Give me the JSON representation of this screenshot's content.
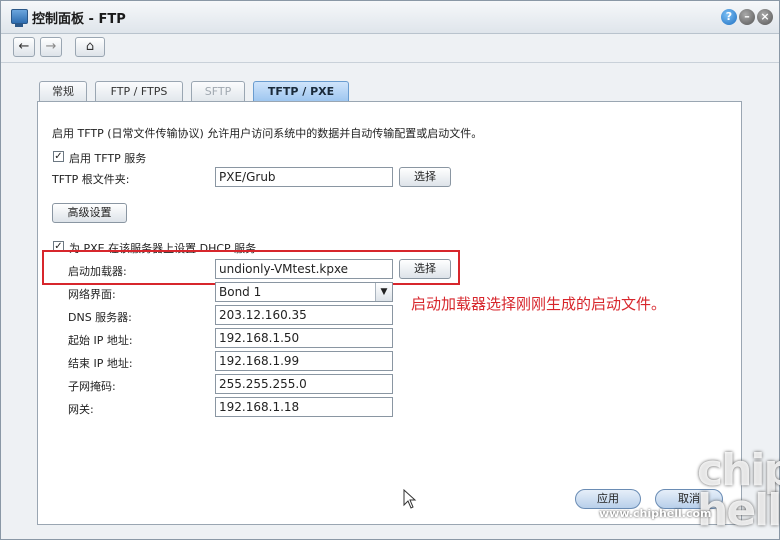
{
  "window": {
    "title": "控制面板 - FTP"
  },
  "nav": {
    "back": "←",
    "forward": "→",
    "home": "⌂"
  },
  "tabs": [
    {
      "label": "常规",
      "state": "normal"
    },
    {
      "label": "FTP / FTPS",
      "state": "normal"
    },
    {
      "label": "SFTP",
      "state": "disabled"
    },
    {
      "label": "TFTP / PXE",
      "state": "active"
    }
  ],
  "content": {
    "description": "启用 TFTP (日常文件传输协议) 允许用户访问系统中的数据并自动传输配置或启动文件。",
    "enable_tftp": {
      "label": "启用 TFTP 服务",
      "checked": true
    },
    "root_folder": {
      "label": "TFTP 根文件夹:",
      "value": "PXE/Grub",
      "button": "选择"
    },
    "advanced_button": "高级设置",
    "pxe_dhcp": {
      "label": "为 PXE 在该服务器上设置 DHCP 服务",
      "checked": true
    },
    "boot_loader": {
      "label": "启动加载器:",
      "value": "undionly-VMtest.kpxe",
      "button": "选择"
    },
    "interface": {
      "label": "网络界面:",
      "value": "Bond 1"
    },
    "dns": {
      "label": "DNS 服务器:",
      "value": "203.12.160.35"
    },
    "start_ip": {
      "label": "起始 IP 地址:",
      "value": "192.168.1.50"
    },
    "end_ip": {
      "label": "结束 IP 地址:",
      "value": "192.168.1.99"
    },
    "netmask": {
      "label": "子网掩码:",
      "value": "255.255.255.0"
    },
    "gateway": {
      "label": "网关:",
      "value": "192.168.1.18"
    }
  },
  "annotation": "启动加载器选择刚刚生成的启动文件。",
  "footer": {
    "apply": "应用",
    "cancel": "取消"
  },
  "watermark": {
    "url": "www.chiphell.com",
    "logo": "chip hell"
  },
  "colors": {
    "annotation": "#d7262c",
    "active_tab": "#9cc5ef"
  }
}
